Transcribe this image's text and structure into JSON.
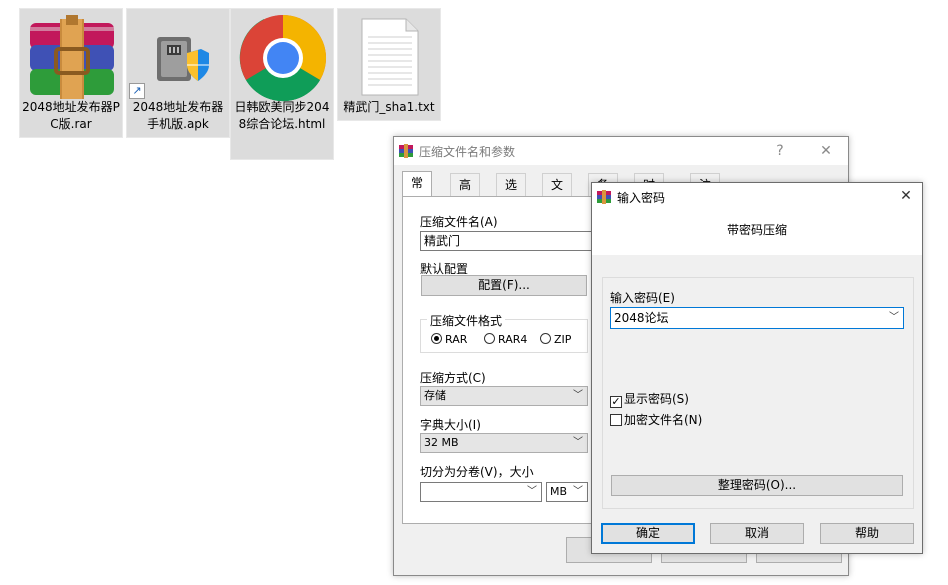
{
  "desktop": {
    "icons": [
      {
        "label": "2048地址发布器PC版.rar"
      },
      {
        "label": "2048地址发布器手机版.apk"
      },
      {
        "label": "日韩欧美同步2048综合论坛.html"
      },
      {
        "label": "精武门_sha1.txt"
      }
    ]
  },
  "archive_dialog": {
    "title": "压缩文件名和参数",
    "help_btn": "?",
    "close_btn": "✕",
    "tabs": [
      "常规",
      "高级",
      "选项",
      "文件",
      "备份",
      "时间",
      "注释"
    ],
    "archive_name_label": "压缩文件名(A)",
    "archive_name_value": "精武门",
    "profile_label": "默认配置",
    "profile_button": "配置(F)...",
    "format_group_title": "压缩文件格式",
    "formats": [
      "RAR",
      "RAR4",
      "ZIP"
    ],
    "selected_format": "RAR",
    "method_label": "压缩方式(C)",
    "method_value": "存储",
    "dict_label": "字典大小(I)",
    "dict_value": "32 MB",
    "split_label": "切分为分卷(V)，大小",
    "split_value": "",
    "split_unit": "MB"
  },
  "password_dialog": {
    "title": "输入密码",
    "close_btn": "✕",
    "heading": "带密码压缩",
    "password_label": "输入密码(E)",
    "password_value": "2048论坛",
    "show_password_label": "显示密码(S)",
    "show_password_checked": true,
    "encrypt_names_label": "加密文件名(N)",
    "encrypt_names_checked": false,
    "organize_button": "整理密码(O)...",
    "ok_button": "确定",
    "cancel_button": "取消",
    "help_button": "帮助"
  },
  "colors": {
    "dialog_bg": "#f0f0f0",
    "accent_border": "#0078d7",
    "icon_selected_bg": "#dcdcdc"
  }
}
